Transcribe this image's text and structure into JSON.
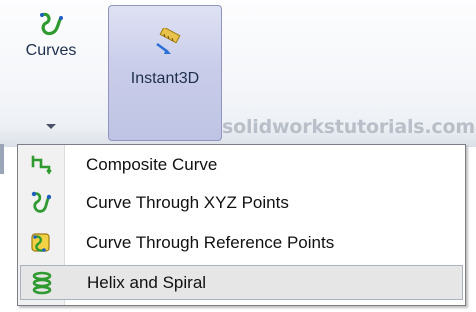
{
  "ribbon": {
    "curves_label": "Curves",
    "instant3d_label": "Instant3D",
    "watermark": "solidworkstutorials.com"
  },
  "menu": {
    "items": [
      {
        "label": "Composite Curve",
        "icon": "composite-curve-icon"
      },
      {
        "label": "Curve Through XYZ Points",
        "icon": "curve-xyz-points-icon"
      },
      {
        "label": "Curve Through Reference Points",
        "icon": "curve-reference-points-icon"
      },
      {
        "label": "Helix and Spiral",
        "icon": "helix-spiral-icon",
        "highlighted": true
      }
    ]
  },
  "colors": {
    "curve_green": "#2f9a2f",
    "instant_bg": "#c9cdea",
    "highlight": "#e6e6e6"
  }
}
